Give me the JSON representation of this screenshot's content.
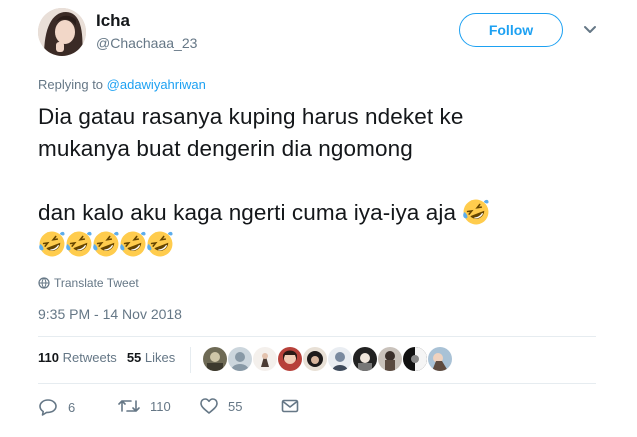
{
  "author": {
    "display_name": "Icha",
    "handle": "@Chachaaa_23"
  },
  "follow_label": "Follow",
  "reply_context": {
    "prefix": "Replying to ",
    "mention": "@adawiyahriwan"
  },
  "tweet": {
    "line1": "Dia gatau rasanya kuping harus ndeket ke",
    "line2": "mukanya buat dengerin dia ngomong",
    "line3": "dan kalo aku kaga ngerti cuma iya-iya aja",
    "emoji_name": "rolling-on-floor-laughing-emoji"
  },
  "translate_label": "Translate Tweet",
  "timestamp": "9:35 PM - 14 Nov 2018",
  "stats": {
    "retweets_count": "110",
    "retweets_label": "Retweets",
    "likes_count": "55",
    "likes_label": "Likes"
  },
  "actions": {
    "replies": "6",
    "retweets": "110",
    "likes": "55"
  },
  "colors": {
    "accent": "#1da1f2",
    "muted": "#657786",
    "text": "#14171a",
    "divider": "#e6ecf0"
  }
}
